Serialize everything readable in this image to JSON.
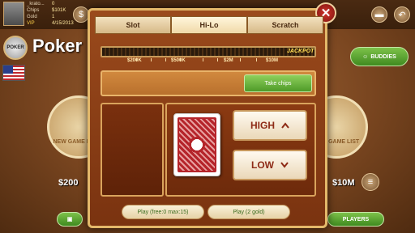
{
  "profile": {
    "name": "_krato...",
    "name_value": "0",
    "chips_label": "Chips",
    "chips_value": "$101K",
    "gold_label": "Gold",
    "gold_value": "1",
    "vip_label": "VIP",
    "date": "4/15/2013"
  },
  "lobby": {
    "title": "Poker",
    "logo_text": "POKER",
    "buddies_label": "BUDDIES",
    "new_game_room_label": "NEW GAME ROOM",
    "new_game_list_label": "NEW GAME LIST",
    "left_amount": "$200",
    "right_amount": "$10M",
    "players_label": "PLAYERS"
  },
  "tabs": [
    {
      "label": "Slot",
      "active": false
    },
    {
      "label": "Hi-Lo",
      "active": true
    },
    {
      "label": "Scratch",
      "active": false
    }
  ],
  "jackpot": {
    "label": "JACKPOT",
    "marks": [
      "$200K",
      "$500K",
      "$2M",
      "$10M"
    ]
  },
  "take_chips_label": "Take chips",
  "buttons": {
    "high_label": "HIGH",
    "low_label": "LOW",
    "play_free_label": "Play (free:0 max:15)",
    "play_gold_label": "Play (2 gold)"
  },
  "colors": {
    "modal_wood": "#7a3310",
    "accent_gold": "#e3b86a",
    "green_button": "#4e9a28",
    "close_red": "#d2342a",
    "bet_text": "#8e2b17"
  },
  "icons": {
    "close": "close-icon",
    "high": "chevron-up-icon",
    "low": "chevron-down-icon",
    "card": "card-back-icon"
  }
}
